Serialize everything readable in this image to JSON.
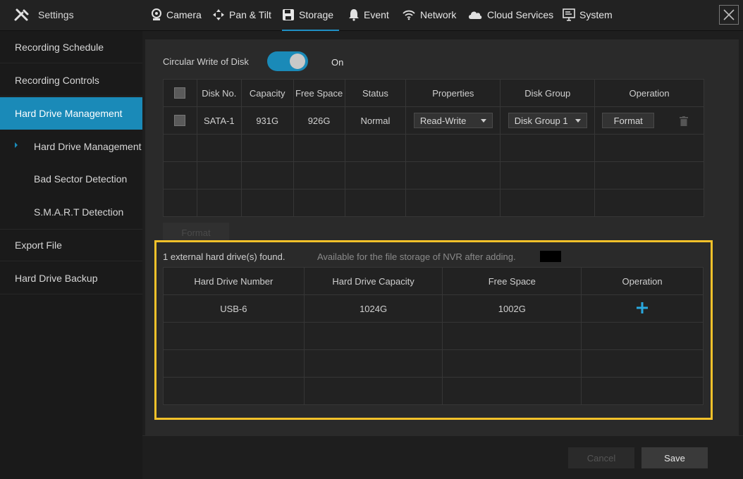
{
  "header": {
    "settings_label": "Settings",
    "tabs": [
      {
        "label": "Camera",
        "icon": "camera-icon"
      },
      {
        "label": "Pan & Tilt",
        "icon": "pan-tilt-icon"
      },
      {
        "label": "Storage",
        "icon": "save-disk-icon"
      },
      {
        "label": "Event",
        "icon": "bell-icon"
      },
      {
        "label": "Network",
        "icon": "wifi-icon"
      },
      {
        "label": "Cloud Services",
        "icon": "cloud-icon"
      },
      {
        "label": "System",
        "icon": "monitor-icon"
      }
    ],
    "active_tab": "Storage",
    "accent_color": "#1a8ab8"
  },
  "sidebar": {
    "items": [
      {
        "label": "Recording Schedule"
      },
      {
        "label": "Recording Controls"
      },
      {
        "label": "Hard Drive Management"
      },
      {
        "label": "Hard Drive Management"
      },
      {
        "label": "Bad Sector Detection"
      },
      {
        "label": "S.M.A.R.T Detection"
      },
      {
        "label": "Export File"
      },
      {
        "label": "Hard Drive Backup"
      }
    ]
  },
  "main": {
    "circular_write_label": "Circular Write of Disk",
    "circular_write_state": "On",
    "disk_table": {
      "headers": [
        "Disk No.",
        "Capacity",
        "Free Space",
        "Status",
        "Properties",
        "Disk Group",
        "Operation"
      ],
      "rows": [
        {
          "disk_no": "SATA-1",
          "capacity": "931G",
          "free_space": "926G",
          "status": "Normal",
          "properties": "Read-Write",
          "disk_group": "Disk Group 1",
          "operation": "Format"
        }
      ]
    },
    "format_button_label": "Format",
    "external": {
      "found_text": "1 external hard drive(s) found.",
      "hint_text": "Available for the file storage of NVR after adding.",
      "headers": [
        "Hard Drive Number",
        "Hard Drive Capacity",
        "Free Space",
        "Operation"
      ],
      "rows": [
        {
          "number": "USB-6",
          "capacity": "1024G",
          "free_space": "1002G",
          "operation_icon": "plus-icon"
        }
      ]
    },
    "highlight_color": "#f2c12a"
  },
  "footer": {
    "cancel_label": "Cancel",
    "save_label": "Save"
  }
}
